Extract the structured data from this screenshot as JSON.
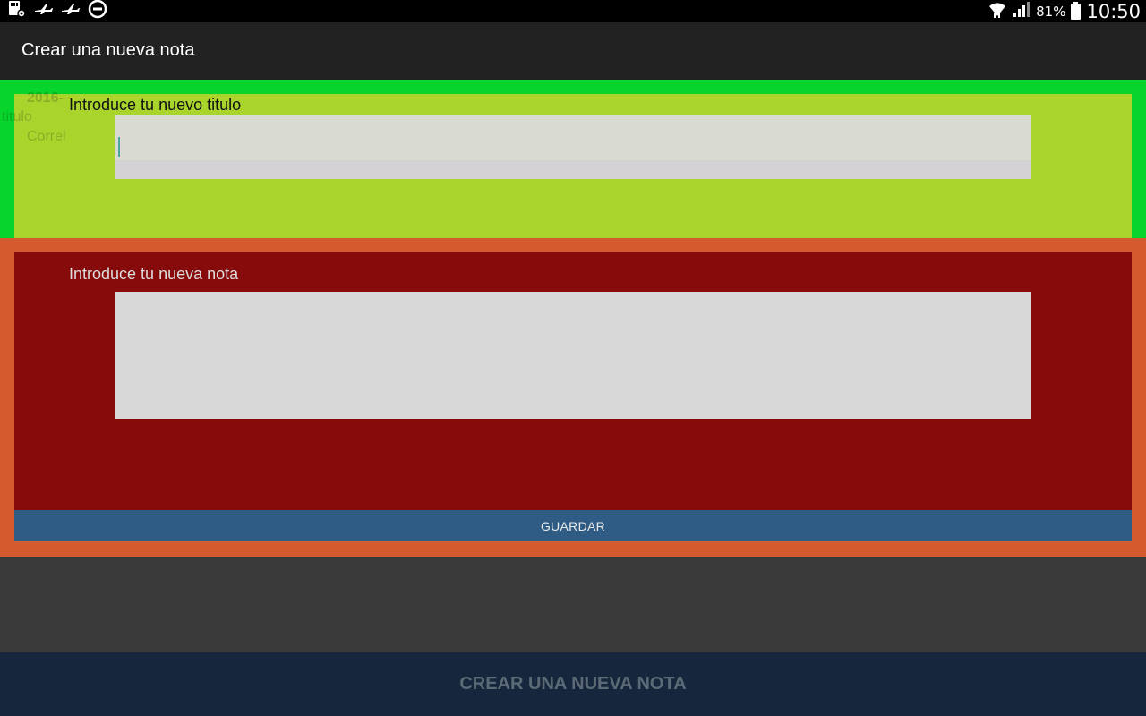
{
  "status_bar": {
    "icons_left": [
      "sd-card-settings-icon",
      "airplane-icon",
      "airplane-icon",
      "do-not-disturb-icon"
    ],
    "icons_right": [
      "wifi-icon",
      "signal-icon",
      "battery-icon"
    ],
    "battery": "81%",
    "time": "10:50"
  },
  "action_bar": {
    "title": "Crear una nueva nota"
  },
  "background_list": {
    "item_date": "2016-",
    "item_title": "titulo",
    "item_preview": "Correl"
  },
  "dialog": {
    "title_label": "Introduce tu nuevo titulo",
    "title_value": "",
    "note_label": "Introduce tu nueva nota",
    "note_value": "",
    "save_button": "GUARDAR"
  },
  "bottom": {
    "create_button": "CREAR UNA NUEVA NOTA"
  },
  "colors": {
    "title_panel_outer": "#08d52b",
    "title_panel_inner": "#a8d42c",
    "note_panel_outer": "#d45a30",
    "note_panel_inner": "#870b0b",
    "save_button": "#2e5c84",
    "bottom_button": "#16273d"
  }
}
